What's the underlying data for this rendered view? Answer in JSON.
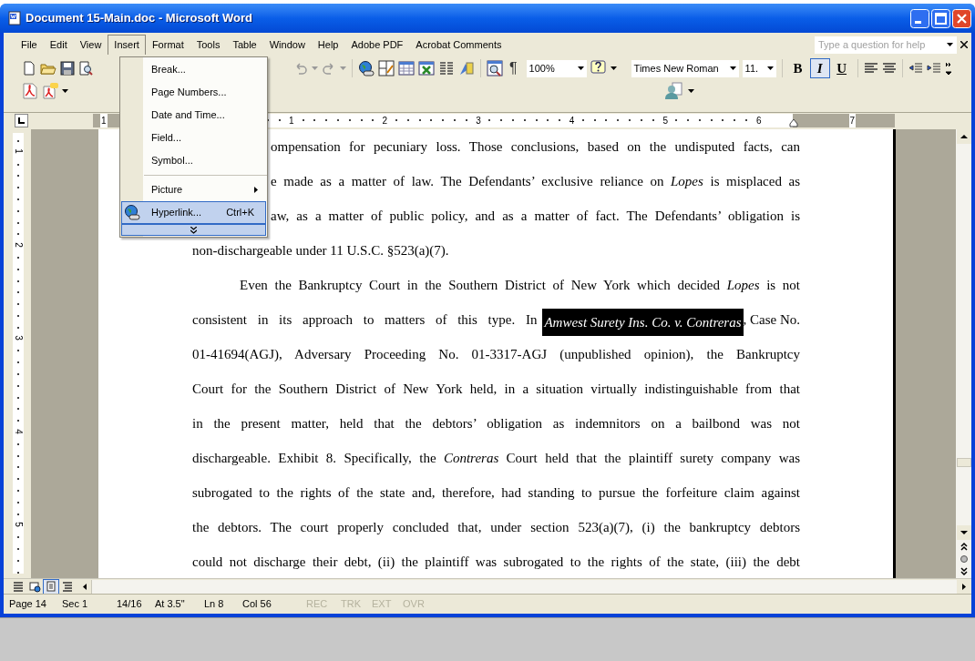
{
  "window": {
    "title": "Document 15-Main.doc - Microsoft Word"
  },
  "menu_bar": [
    {
      "label": "File",
      "selected": false
    },
    {
      "label": "Edit",
      "selected": false
    },
    {
      "label": "View",
      "selected": false
    },
    {
      "label": "Insert",
      "selected": true
    },
    {
      "label": "Format",
      "selected": false
    },
    {
      "label": "Tools",
      "selected": false
    },
    {
      "label": "Table",
      "selected": false
    },
    {
      "label": "Window",
      "selected": false
    },
    {
      "label": "Help",
      "selected": false
    },
    {
      "label": "Adobe PDF",
      "selected": false
    },
    {
      "label": "Acrobat Comments",
      "selected": false
    }
  ],
  "help_box": {
    "placeholder": "Type a question for help"
  },
  "toolbar": {
    "zoom": "100%",
    "paragraph_mark": "¶",
    "font": "Times New Roman",
    "font_size": "11.",
    "format_buttons": [
      {
        "label": "B",
        "selected": false
      },
      {
        "label": "I",
        "selected": true
      },
      {
        "label": "U",
        "selected": false
      }
    ]
  },
  "insert_menu": [
    {
      "kind": "item",
      "label": "Break...",
      "submenu": false,
      "selected": false
    },
    {
      "kind": "item",
      "label": "Page Numbers...",
      "submenu": false,
      "selected": false
    },
    {
      "kind": "item",
      "label": "Date and Time...",
      "submenu": false,
      "selected": false
    },
    {
      "kind": "item",
      "label": "Field...",
      "submenu": false,
      "selected": false
    },
    {
      "kind": "item",
      "label": "Symbol...",
      "submenu": false,
      "selected": false
    },
    {
      "kind": "separator"
    },
    {
      "kind": "item",
      "label": "Picture",
      "submenu": true,
      "selected": false
    },
    {
      "kind": "item",
      "label": "Hyperlink...",
      "shortcut": "Ctrl+K",
      "submenu": false,
      "selected": true
    },
    {
      "kind": "expand",
      "selected": true
    }
  ],
  "ruler": {
    "labels": [
      "1",
      "1",
      "2",
      "3",
      "4",
      "5",
      "6",
      "7"
    ]
  },
  "vertical_ruler": {
    "labels": [
      "1",
      "2",
      "3",
      "4",
      "5"
    ]
  },
  "document": {
    "paragraphs": [
      {
        "last_line_ends": true,
        "lines": [
          {
            "text": "ompensation for pecuniary loss. Those conclusions, based on the undisputed facts, can"
          },
          {
            "text": "e made as a matter of law. The Defendants’ exclusive reliance on *Lopes* is misplaced as"
          },
          {
            "text": "aw, as a matter of public policy, and as a matter of fact. The Defendants’ obligation is"
          },
          {
            "text": "non-dischargeable under 11 U.S.C. §523(a)(7)."
          }
        ]
      },
      {
        "indented_first_line": true,
        "last_line_ends": false,
        "lines": [
          {
            "text": "Even the Bankruptcy Court in the Southern District of New York which decided *Lopes* is not"
          },
          {
            "text": "consistent in its approach to matters of this type. In",
            "selection": "Amwest Surety Ins. Co. v. Contreras",
            "after": ", Case No."
          },
          {
            "text": "01-41694(AGJ), Adversary Proceeding No. 01-3317-AGJ (unpublished opinion), the Bankruptcy"
          },
          {
            "text": "Court for the Southern District of New York held, in a situation virtually indistinguishable from that"
          },
          {
            "text": "in the present matter, held that the debtors’ obligation as indemnitors on a bailbond was not"
          },
          {
            "text": "dischargeable. Exhibit 8. Specifically, the *Contreras* Court held that the plaintiff surety company was"
          },
          {
            "text": "subrogated to the rights of the state and, therefore, had standing to pursue the forfeiture claim against"
          },
          {
            "text": "the debtors. The court properly concluded that, under section 523(a)(7), (i) the bankruptcy debtors"
          },
          {
            "text": "could not discharge their debt, (ii) the plaintiff was subrogated to the rights of the state, (iii) the debt"
          }
        ]
      }
    ]
  },
  "view_modes": [
    {
      "selected": false
    },
    {
      "selected": false
    },
    {
      "selected": true
    },
    {
      "selected": false
    }
  ],
  "status_bar": [
    {
      "label": "Page 14",
      "disabled": false
    },
    {
      "label": "Sec 1",
      "disabled": false
    },
    {
      "label": "14/16",
      "disabled": false
    },
    {
      "label": "At 3.5\"",
      "disabled": false
    },
    {
      "label": "Ln 8",
      "disabled": false
    },
    {
      "label": "Col 56",
      "disabled": false
    },
    {
      "label": "REC",
      "disabled": true
    },
    {
      "label": "TRK",
      "disabled": true
    },
    {
      "label": "EXT",
      "disabled": true
    },
    {
      "label": "OVR",
      "disabled": true
    }
  ]
}
